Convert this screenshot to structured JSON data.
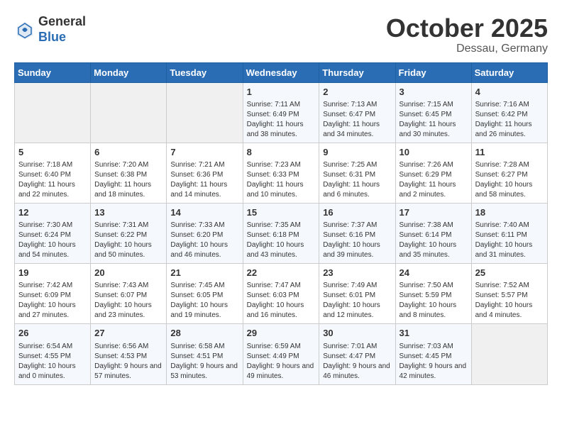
{
  "header": {
    "logo_general": "General",
    "logo_blue": "Blue",
    "month": "October 2025",
    "location": "Dessau, Germany"
  },
  "days_of_week": [
    "Sunday",
    "Monday",
    "Tuesday",
    "Wednesday",
    "Thursday",
    "Friday",
    "Saturday"
  ],
  "weeks": [
    [
      {
        "day": "",
        "info": ""
      },
      {
        "day": "",
        "info": ""
      },
      {
        "day": "",
        "info": ""
      },
      {
        "day": "1",
        "info": "Sunrise: 7:11 AM\nSunset: 6:49 PM\nDaylight: 11 hours and 38 minutes."
      },
      {
        "day": "2",
        "info": "Sunrise: 7:13 AM\nSunset: 6:47 PM\nDaylight: 11 hours and 34 minutes."
      },
      {
        "day": "3",
        "info": "Sunrise: 7:15 AM\nSunset: 6:45 PM\nDaylight: 11 hours and 30 minutes."
      },
      {
        "day": "4",
        "info": "Sunrise: 7:16 AM\nSunset: 6:42 PM\nDaylight: 11 hours and 26 minutes."
      }
    ],
    [
      {
        "day": "5",
        "info": "Sunrise: 7:18 AM\nSunset: 6:40 PM\nDaylight: 11 hours and 22 minutes."
      },
      {
        "day": "6",
        "info": "Sunrise: 7:20 AM\nSunset: 6:38 PM\nDaylight: 11 hours and 18 minutes."
      },
      {
        "day": "7",
        "info": "Sunrise: 7:21 AM\nSunset: 6:36 PM\nDaylight: 11 hours and 14 minutes."
      },
      {
        "day": "8",
        "info": "Sunrise: 7:23 AM\nSunset: 6:33 PM\nDaylight: 11 hours and 10 minutes."
      },
      {
        "day": "9",
        "info": "Sunrise: 7:25 AM\nSunset: 6:31 PM\nDaylight: 11 hours and 6 minutes."
      },
      {
        "day": "10",
        "info": "Sunrise: 7:26 AM\nSunset: 6:29 PM\nDaylight: 11 hours and 2 minutes."
      },
      {
        "day": "11",
        "info": "Sunrise: 7:28 AM\nSunset: 6:27 PM\nDaylight: 10 hours and 58 minutes."
      }
    ],
    [
      {
        "day": "12",
        "info": "Sunrise: 7:30 AM\nSunset: 6:24 PM\nDaylight: 10 hours and 54 minutes."
      },
      {
        "day": "13",
        "info": "Sunrise: 7:31 AM\nSunset: 6:22 PM\nDaylight: 10 hours and 50 minutes."
      },
      {
        "day": "14",
        "info": "Sunrise: 7:33 AM\nSunset: 6:20 PM\nDaylight: 10 hours and 46 minutes."
      },
      {
        "day": "15",
        "info": "Sunrise: 7:35 AM\nSunset: 6:18 PM\nDaylight: 10 hours and 43 minutes."
      },
      {
        "day": "16",
        "info": "Sunrise: 7:37 AM\nSunset: 6:16 PM\nDaylight: 10 hours and 39 minutes."
      },
      {
        "day": "17",
        "info": "Sunrise: 7:38 AM\nSunset: 6:14 PM\nDaylight: 10 hours and 35 minutes."
      },
      {
        "day": "18",
        "info": "Sunrise: 7:40 AM\nSunset: 6:11 PM\nDaylight: 10 hours and 31 minutes."
      }
    ],
    [
      {
        "day": "19",
        "info": "Sunrise: 7:42 AM\nSunset: 6:09 PM\nDaylight: 10 hours and 27 minutes."
      },
      {
        "day": "20",
        "info": "Sunrise: 7:43 AM\nSunset: 6:07 PM\nDaylight: 10 hours and 23 minutes."
      },
      {
        "day": "21",
        "info": "Sunrise: 7:45 AM\nSunset: 6:05 PM\nDaylight: 10 hours and 19 minutes."
      },
      {
        "day": "22",
        "info": "Sunrise: 7:47 AM\nSunset: 6:03 PM\nDaylight: 10 hours and 16 minutes."
      },
      {
        "day": "23",
        "info": "Sunrise: 7:49 AM\nSunset: 6:01 PM\nDaylight: 10 hours and 12 minutes."
      },
      {
        "day": "24",
        "info": "Sunrise: 7:50 AM\nSunset: 5:59 PM\nDaylight: 10 hours and 8 minutes."
      },
      {
        "day": "25",
        "info": "Sunrise: 7:52 AM\nSunset: 5:57 PM\nDaylight: 10 hours and 4 minutes."
      }
    ],
    [
      {
        "day": "26",
        "info": "Sunrise: 6:54 AM\nSunset: 4:55 PM\nDaylight: 10 hours and 0 minutes."
      },
      {
        "day": "27",
        "info": "Sunrise: 6:56 AM\nSunset: 4:53 PM\nDaylight: 9 hours and 57 minutes."
      },
      {
        "day": "28",
        "info": "Sunrise: 6:58 AM\nSunset: 4:51 PM\nDaylight: 9 hours and 53 minutes."
      },
      {
        "day": "29",
        "info": "Sunrise: 6:59 AM\nSunset: 4:49 PM\nDaylight: 9 hours and 49 minutes."
      },
      {
        "day": "30",
        "info": "Sunrise: 7:01 AM\nSunset: 4:47 PM\nDaylight: 9 hours and 46 minutes."
      },
      {
        "day": "31",
        "info": "Sunrise: 7:03 AM\nSunset: 4:45 PM\nDaylight: 9 hours and 42 minutes."
      },
      {
        "day": "",
        "info": ""
      }
    ]
  ]
}
